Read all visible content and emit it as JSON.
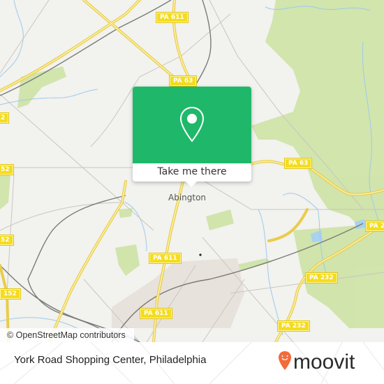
{
  "map": {
    "town_label": "Abington",
    "route_shields": [
      {
        "id": "pa611-top",
        "label": "PA 611"
      },
      {
        "id": "pa63-top",
        "label": "PA 63"
      },
      {
        "id": "pa63-right",
        "label": "PA 63"
      },
      {
        "id": "pa611-mid",
        "label": "PA 611"
      },
      {
        "id": "pa611-low",
        "label": "PA 611"
      },
      {
        "id": "pa232-mid",
        "label": "PA 232"
      },
      {
        "id": "pa232-low",
        "label": "PA 232"
      },
      {
        "id": "pa2-right",
        "label": "PA 2"
      },
      {
        "id": "r152-a",
        "label": "2"
      },
      {
        "id": "r152-b",
        "label": "52"
      },
      {
        "id": "r152-c",
        "label": "52"
      },
      {
        "id": "r152-d",
        "label": "152"
      }
    ],
    "attribution": "© OpenStreetMap contributors"
  },
  "popup": {
    "icon": "map-pin-icon",
    "button_label": "Take me there",
    "color": "#1fb86a"
  },
  "footer": {
    "place_name": "York Road Shopping Center, Philadelphia",
    "brand": "moovit",
    "brand_color": "#f26b3a"
  }
}
